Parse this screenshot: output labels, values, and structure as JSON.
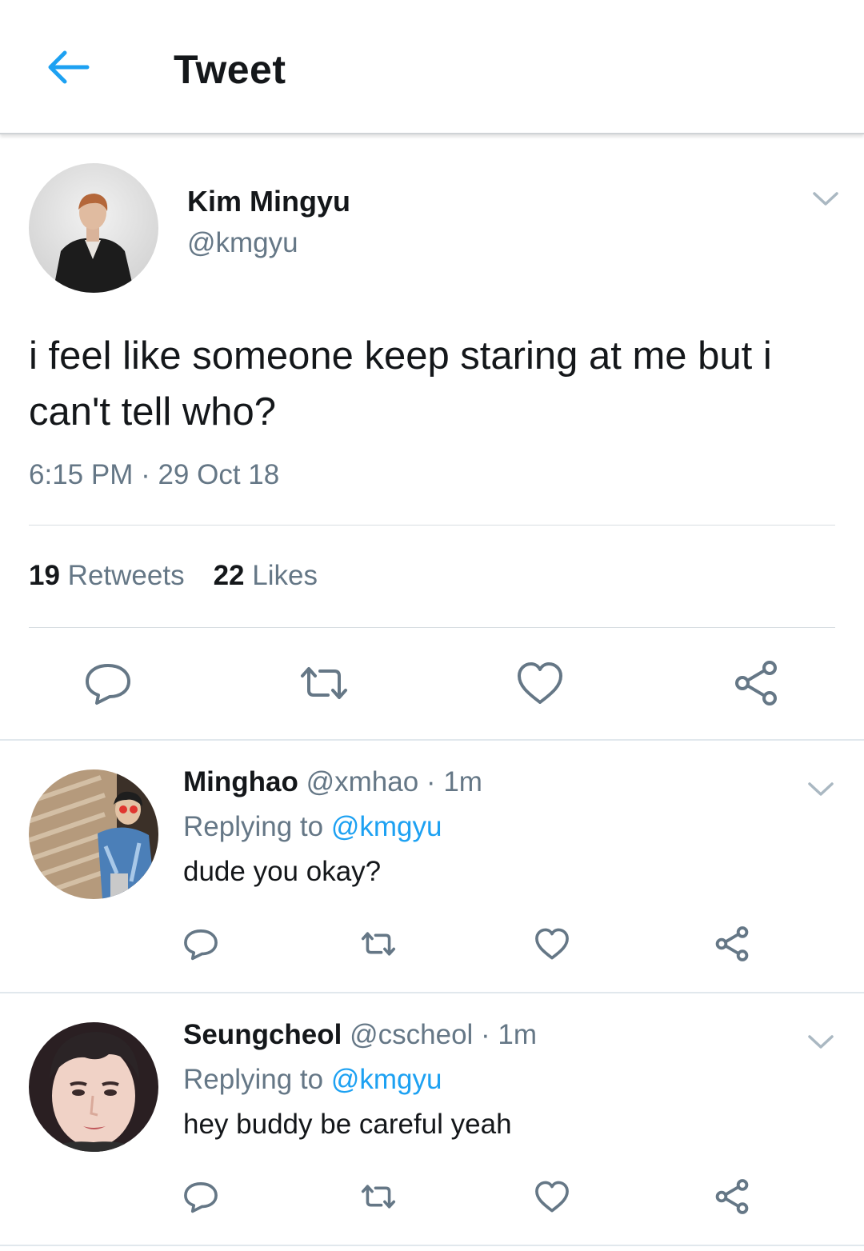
{
  "header": {
    "title": "Tweet",
    "back_icon": "arrow-left-icon",
    "accent": "#1da1f2"
  },
  "tweet": {
    "author": {
      "name": "Kim Mingyu",
      "handle": "@kmgyu"
    },
    "text": "i feel like someone keep staring at me but i can't tell who?",
    "time": "6:15 PM",
    "date": "29 Oct 18",
    "retweets": {
      "count": "19",
      "label": "Retweets"
    },
    "likes": {
      "count": "22",
      "label": "Likes"
    },
    "actions": [
      "reply-icon",
      "retweet-icon",
      "heart-icon",
      "share-icon"
    ]
  },
  "replies": [
    {
      "name": "Minghao",
      "handle": "@xmhao",
      "time": "1m",
      "replying_label": "Replying to",
      "replying_to": "@kmgyu",
      "text": "dude you okay?"
    },
    {
      "name": "Seungcheol",
      "handle": "@cscheol",
      "time": "1m",
      "replying_label": "Replying to",
      "replying_to": "@kmgyu",
      "text": "hey buddy be careful yeah"
    }
  ],
  "colors": {
    "text": "#14171a",
    "secondary": "#657786",
    "link": "#1da1f2",
    "divider": "#e1e8ed"
  }
}
